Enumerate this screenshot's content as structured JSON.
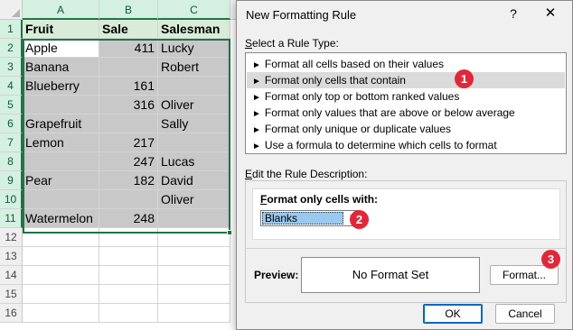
{
  "sheet": {
    "columns": [
      "A",
      "B",
      "C"
    ],
    "rows": [
      "1",
      "2",
      "3",
      "4",
      "5",
      "6",
      "7",
      "8",
      "9",
      "10",
      "11",
      "12",
      "13",
      "14",
      "15",
      "16"
    ],
    "headers": {
      "fruit": "Fruit",
      "sale": "Sale",
      "saleman": "Salesman"
    },
    "data": [
      {
        "fruit": "Apple",
        "sale": "411",
        "saleman": "Lucky"
      },
      {
        "fruit": "Banana",
        "sale": "",
        "saleman": "Robert"
      },
      {
        "fruit": "Blueberry",
        "sale": "161",
        "saleman": ""
      },
      {
        "fruit": "",
        "sale": "316",
        "saleman": "Oliver"
      },
      {
        "fruit": "Grapefruit",
        "sale": "",
        "saleman": "Sally"
      },
      {
        "fruit": "Lemon",
        "sale": "217",
        "saleman": ""
      },
      {
        "fruit": "",
        "sale": "247",
        "saleman": "Lucas"
      },
      {
        "fruit": "Pear",
        "sale": "182",
        "saleman": "David"
      },
      {
        "fruit": "",
        "sale": "",
        "saleman": "Oliver"
      },
      {
        "fruit": "Watermelon",
        "sale": "248",
        "saleman": ""
      }
    ]
  },
  "dialog": {
    "title": "New Formatting Rule",
    "help": "?",
    "close": "✕",
    "select_rule_type_prefix": "S",
    "select_rule_type_rest": "elect a Rule Type:",
    "rule_types": [
      "Format all cells based on their values",
      "Format only cells that contain",
      "Format only top or bottom ranked values",
      "Format only values that are above or below average",
      "Format only unique or duplicate values",
      "Use a formula to determine which cells to format"
    ],
    "selected_rule_index": 1,
    "edit_desc_prefix": "E",
    "edit_desc_rest": "dit the Rule Description:",
    "format_only_prefix": "F",
    "format_only_rest": "ormat only cells with:",
    "condition_value": "Blanks",
    "preview_label": "Preview:",
    "preview_text": "No Format Set",
    "format_button": "Format...",
    "ok_button": "OK",
    "cancel_button": "Cancel",
    "badges": [
      "1",
      "2",
      "3"
    ]
  },
  "colors": {
    "selection": "#217346",
    "badge": "#e0283a",
    "header_fill": "#d9ecd9",
    "shade": "#c8c8c8"
  }
}
